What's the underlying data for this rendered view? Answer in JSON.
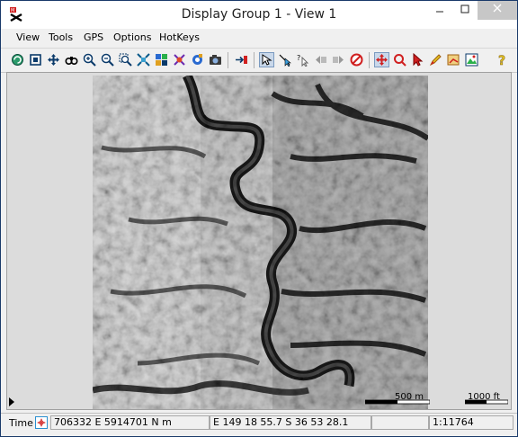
{
  "window": {
    "title": "Display Group 1 - View 1"
  },
  "menu": [
    "View",
    "Tools",
    "GPS",
    "Options",
    "HotKeys"
  ],
  "toolbar": {
    "icons": [
      "redraw-icon",
      "full-extent-icon",
      "pan-icon",
      "binoculars-icon",
      "zoom-in-icon",
      "zoom-out-icon",
      "zoom-box-icon",
      "zoom-extent-icon",
      "layer-icon",
      "grid-icon",
      "settings-icon",
      "camera-icon",
      "add-layer-icon",
      "select-cursor-icon",
      "measure-icon",
      "help-cursor-icon",
      "back-icon",
      "forward-icon",
      "cancel-icon",
      "move-icon",
      "target-icon",
      "pointer-icon",
      "pencil-icon",
      "sketch-icon",
      "image-icon",
      "question-icon"
    ]
  },
  "map": {
    "scale_bar_1": "500 m",
    "scale_bar_2": "1000 ft"
  },
  "status": {
    "time_label": "Time",
    "utm": "706332 E  5914701 N m",
    "latlon": "E 149 18 55.7  S 36 53 28.1",
    "scale": "1:11764"
  },
  "colors": {
    "accent": "#1a3a6a",
    "pressed": "#c9d8ea"
  }
}
